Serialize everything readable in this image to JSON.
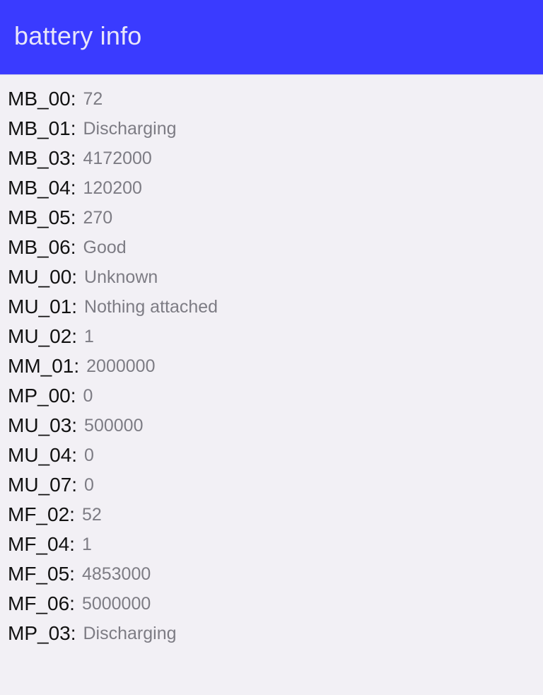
{
  "appbar": {
    "title": "battery info",
    "color": "#3a3bff"
  },
  "items": [
    {
      "key": "MB_00:",
      "value": "72"
    },
    {
      "key": "MB_01:",
      "value": "Discharging"
    },
    {
      "key": "MB_03:",
      "value": "4172000"
    },
    {
      "key": "MB_04:",
      "value": "120200"
    },
    {
      "key": "MB_05:",
      "value": "270"
    },
    {
      "key": "MB_06:",
      "value": "Good"
    },
    {
      "key": "MU_00:",
      "value": "Unknown"
    },
    {
      "key": "MU_01:",
      "value": "Nothing attached"
    },
    {
      "key": "MU_02:",
      "value": "1"
    },
    {
      "key": "MM_01:",
      "value": "2000000"
    },
    {
      "key": "MP_00:",
      "value": "0"
    },
    {
      "key": "MU_03:",
      "value": "500000"
    },
    {
      "key": "MU_04:",
      "value": "0"
    },
    {
      "key": "MU_07:",
      "value": "0"
    },
    {
      "key": "MF_02:",
      "value": "52"
    },
    {
      "key": "MF_04:",
      "value": "1"
    },
    {
      "key": "MF_05:",
      "value": "4853000"
    },
    {
      "key": "MF_06:",
      "value": "5000000"
    },
    {
      "key": "MP_03:",
      "value": "Discharging"
    }
  ]
}
